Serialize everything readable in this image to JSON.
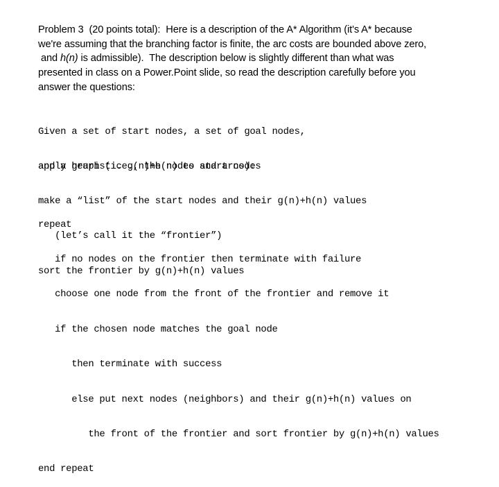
{
  "intro": {
    "lines": [
      "Problem 3  (20 points total):  Here is a description of the A* Algorithm (it's A* because",
      "we're assuming that the branching factor is finite, the arc costs are bounded above zero,",
      " and |h(n)| is admissible).  The description below is slightly different than what was",
      "presented in class on a Power.Point slide, so read the description carefully before you",
      "answer the questions:"
    ],
    "line3_prefix": " and ",
    "line3_italic": "h(n)",
    "line3_suffix": " is admissible).  The description below is slightly different than what was"
  },
  "pseudocode": {
    "block1": [
      "Given a set of start nodes, a set of goal nodes,",
      "and a graph (i.e., the nodes and arcs):"
    ],
    "block2": [
      "apply heuristic g(n)+h(n) to start nodes",
      "make a “list” of the start nodes and their g(n)+h(n) values",
      "   (let’s call it the “frontier”)",
      "sort the frontier by g(n)+h(n) values"
    ],
    "block3": [
      "repeat",
      "   if no nodes on the frontier then terminate with failure",
      "   choose one node from the front of the frontier and remove it",
      "   if the chosen node matches the goal node",
      "      then terminate with success",
      "      else put next nodes (neighbors) and their g(n)+h(n) values on",
      "         the front of the frontier and sort frontier by g(n)+h(n) values",
      "end repeat"
    ]
  }
}
